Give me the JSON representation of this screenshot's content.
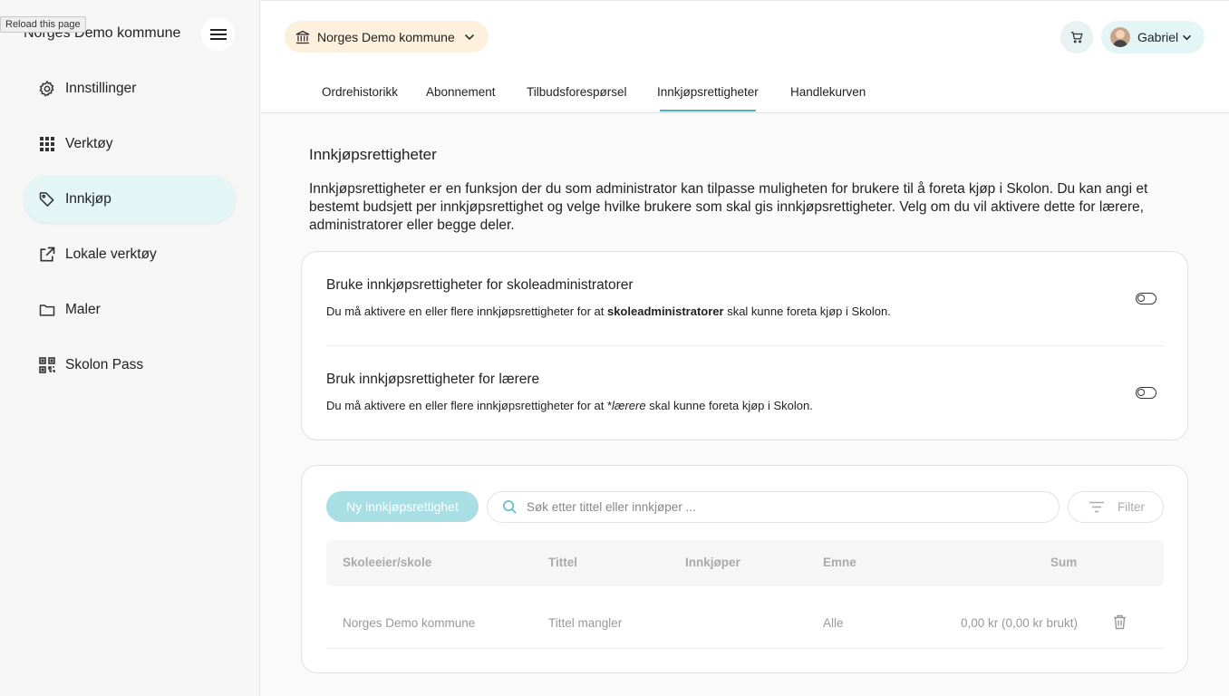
{
  "browser": {
    "tooltip": "Reload this page"
  },
  "sidebar": {
    "brand": "Norges Demo kommune",
    "items": [
      {
        "label": "Innstillinger",
        "icon": "gear-icon"
      },
      {
        "label": "Verktøy",
        "icon": "grid-icon"
      },
      {
        "label": "Innkjøp",
        "icon": "tag-icon",
        "active": true
      },
      {
        "label": "Lokale verktøy",
        "icon": "external-link-icon"
      },
      {
        "label": "Maler",
        "icon": "folder-icon"
      },
      {
        "label": "Skolon Pass",
        "icon": "qr-code-icon"
      }
    ]
  },
  "header": {
    "org": "Norges Demo kommune",
    "user": "Gabriel"
  },
  "tabs": [
    {
      "label": "Ordrehistorikk"
    },
    {
      "label": "Abonnement"
    },
    {
      "label": "Tilbudsforespørsel"
    },
    {
      "label": "Innkjøpsrettigheter",
      "active": true
    },
    {
      "label": "Handlekurven"
    }
  ],
  "main": {
    "title": "Innkjøpsrettigheter",
    "intro": "Innkjøpsrettigheter er en funksjon der du som administrator kan tilpasse muligheten for brukere til å foreta kjøp i Skolon. Du kan angi et bestemt budsjett per innkjøpsrettighet og velge hvilke brukere som skal gis innkjøpsrettigheter. Velg om du vil aktivere dette for lærere, administratorer eller begge deler.",
    "perm_admin": {
      "title": "Bruke innkjøpsrettigheter for skoleadministratorer",
      "desc_pre": "Du må aktivere en eller flere innkjøpsrettigheter for at ",
      "desc_bold": "skoleadministratorer",
      "desc_post": " skal kunne foreta kjøp i Skolon.",
      "enabled": false
    },
    "perm_teacher": {
      "title": "Bruk innkjøpsrettigheter for lærere",
      "desc_pre": "Du må aktivere en eller flere innkjøpsrettigheter for at *",
      "desc_italic": "lærere",
      "desc_post": " skal kunne foreta kjøp i Skolon.",
      "enabled": false
    },
    "new_button": "Ny innkjøpsrettighet",
    "search_placeholder": "Søk etter tittel eller innkjøper ...",
    "filter_label": "Filter",
    "table": {
      "headers": [
        "Skoleeier/skole",
        "Tittel",
        "Innkjøper",
        "Emne",
        "Sum"
      ],
      "rows": [
        {
          "owner": "Norges Demo kommune",
          "title": "Tittel mangler",
          "buyer": "",
          "subject": "Alle",
          "sum": "0,00 kr (0,00 kr brukt)"
        }
      ]
    }
  },
  "colors": {
    "accent": "#4bb6c0",
    "accent_light": "#e4f5f6",
    "org_chip": "#fdf1de",
    "button_disabled": "#a7dfe4"
  }
}
